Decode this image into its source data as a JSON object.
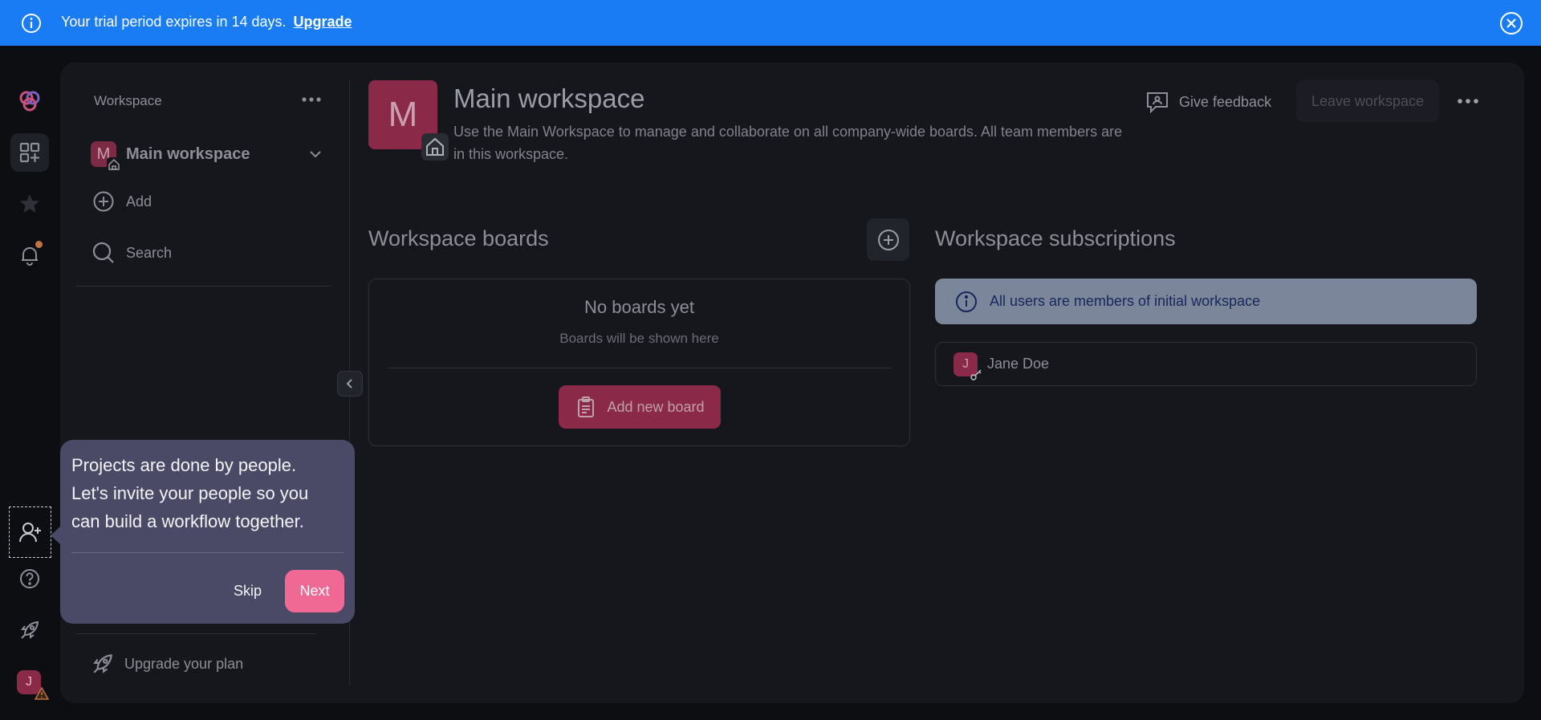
{
  "banner": {
    "message": "Your trial period expires in 14 days.",
    "link": "Upgrade",
    "bg_color": "#1a7cf5"
  },
  "rail": {
    "items": [
      "logo-icon",
      "workspaces-icon",
      "favorites-star-icon",
      "notifications-bell-icon",
      "invite-user-icon",
      "help-icon",
      "rocket-icon"
    ],
    "user_initial": "J"
  },
  "sidebar": {
    "title": "Workspace",
    "workspace_initial": "M",
    "workspace_name": "Main workspace",
    "add_label": "Add",
    "search_label": "Search",
    "upgrade_label": "Upgrade your plan"
  },
  "header": {
    "avatar_initial": "M",
    "title": "Main workspace",
    "description": "Use the Main Workspace to manage and collaborate on all company-wide boards. All team members are in this workspace.",
    "feedback_label": "Give feedback",
    "leave_label": "Leave workspace"
  },
  "boards": {
    "title": "Workspace boards",
    "empty_title": "No boards yet",
    "empty_sub": "Boards will be shown here",
    "add_label": "Add new board"
  },
  "subscriptions": {
    "title": "Workspace subscriptions",
    "info": "All users are members of initial workspace",
    "members": [
      {
        "initial": "J",
        "name": "Jane Doe"
      }
    ]
  },
  "tour": {
    "text": "Projects are done by people. Let's invite your people so you can build a workflow together.",
    "skip": "Skip",
    "next": "Next"
  },
  "colors": {
    "accent": "#f06994",
    "avatar": "#8a2a48",
    "panel": "#16171d"
  }
}
